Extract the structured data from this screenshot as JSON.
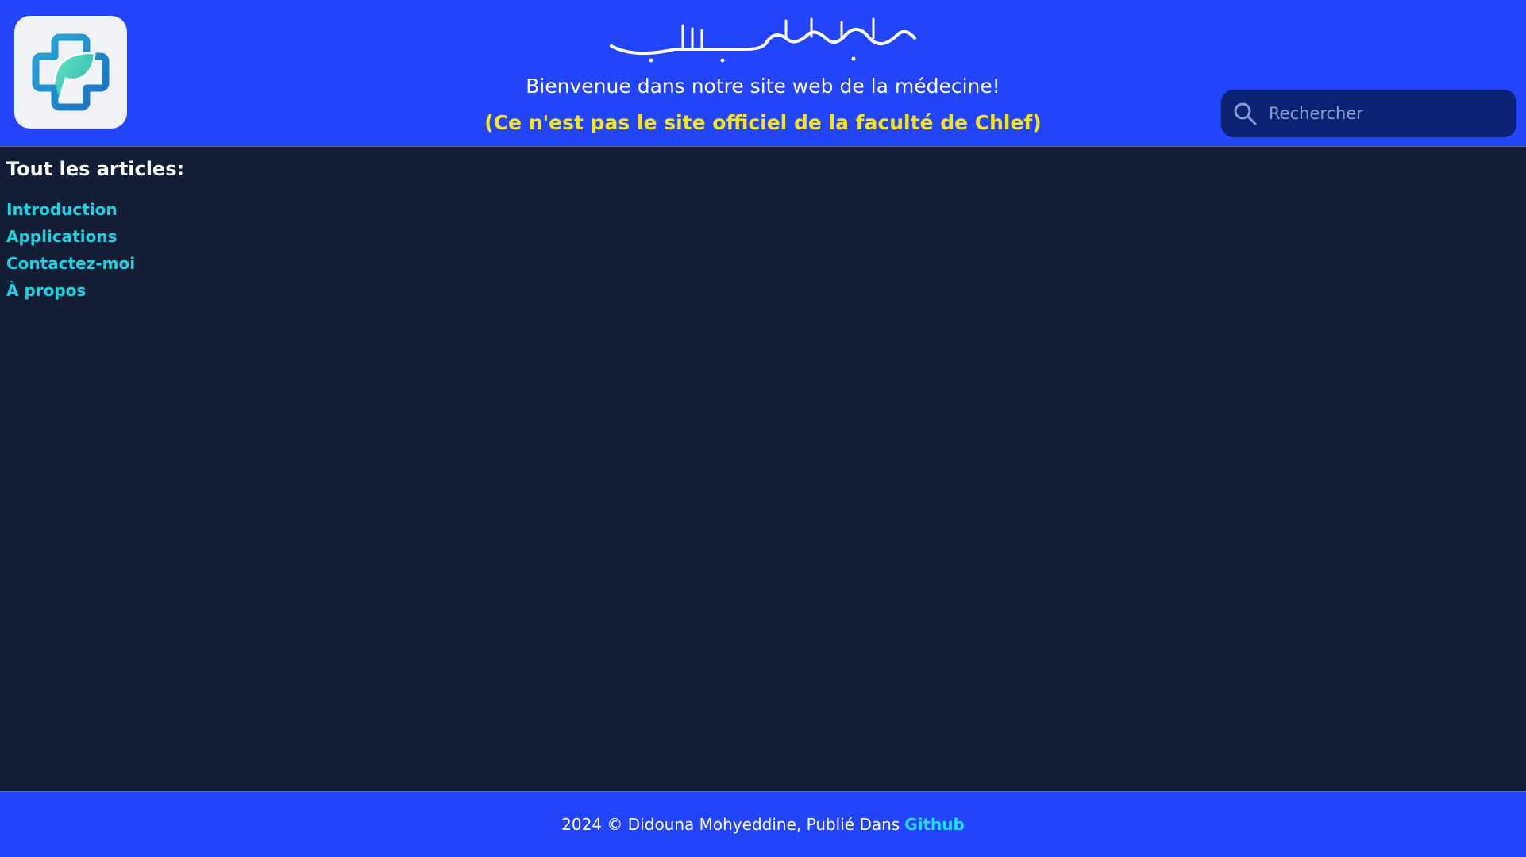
{
  "header": {
    "basmala": "بسم الله الرحمن الرحيم",
    "welcome": "Bienvenue dans notre site web de la médecine!",
    "disclaimer": "(Ce n'est pas le site officiel de la faculté de Chlef)",
    "search": {
      "placeholder": "Rechercher",
      "icon": "search-icon"
    },
    "logo_icon": "medical-cross-leaf-icon"
  },
  "main": {
    "heading": "Tout les articles:",
    "articles": [
      {
        "label": "Introduction"
      },
      {
        "label": "Applications"
      },
      {
        "label": "Contactez-moi"
      },
      {
        "label": "À propos"
      }
    ]
  },
  "footer": {
    "text": "2024 © Didouna Mohyeddine, Publié Dans",
    "link": "Github"
  },
  "colors": {
    "header_bg": "#2244fb",
    "page_bg": "#131d36",
    "link": "#20cfe0",
    "disclaimer": "#f4e520",
    "search_bg": "#0b2173"
  }
}
